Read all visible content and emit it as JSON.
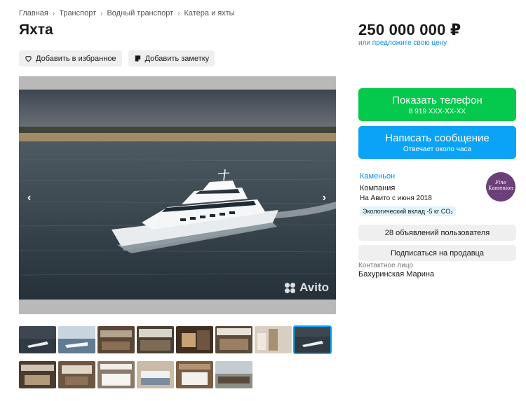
{
  "breadcrumb": [
    "Главная",
    "Транспорт",
    "Водный транспорт",
    "Катера и яхты"
  ],
  "title": "Яхта",
  "actions": {
    "favorite_label": "Добавить в избранное",
    "note_label": "Добавить заметку"
  },
  "price": {
    "value": "250 000 000 ₽",
    "prefix": "или",
    "offer_link": "предложите свою цену"
  },
  "buttons": {
    "phone_label": "Показать телефон",
    "phone_number": "8 919 XXX-XX-XX",
    "message_label": "Написать сообщение",
    "message_sub": "Отвечает около часа"
  },
  "seller": {
    "name": "Каменьон",
    "type": "Компания",
    "since": "На Авито с июня 2018",
    "eco": "Экологический вклад -5 кг CO₂",
    "avatar_text": [
      "Fine",
      "Kamenion",
      "—"
    ]
  },
  "seller_buttons": {
    "ads_count": "28 объявлений пользователя",
    "subscribe": "Подписаться на продавца"
  },
  "contact": {
    "label": "Контактное лицо",
    "name": "Бахуринская Марина"
  },
  "gallery": {
    "watermark": "Avito",
    "prev_icon": "chevron-left-icon",
    "next_icon": "chevron-right-icon",
    "thumbnail_count": 14,
    "active_thumbnail": 8
  },
  "colors": {
    "phone_button": "#04c94c",
    "message_button": "#0aa3f5",
    "link": "#0a8be6",
    "avatar": "#6b3f78"
  }
}
